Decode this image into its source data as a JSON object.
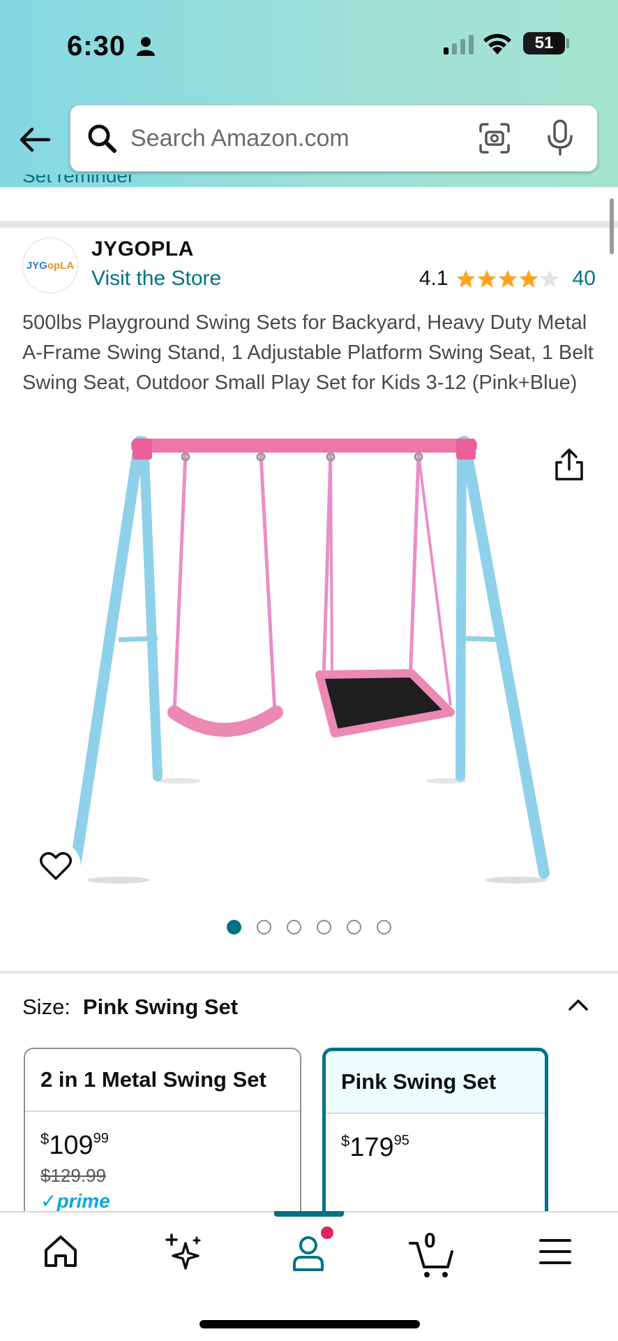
{
  "status_bar": {
    "time": "6:30",
    "battery": "51"
  },
  "search": {
    "placeholder": "Search Amazon.com"
  },
  "reminder_link": "Set reminder",
  "brand": {
    "logo_text_a": "JYG",
    "logo_text_b": "opLA",
    "name": "JYGOPLA",
    "visit_store": "Visit the Store",
    "rating": "4.1",
    "review_count": "40",
    "stars_filled": 4.1
  },
  "product": {
    "title": "500lbs Playground Swing Sets for Backyard, Heavy Duty Metal A-Frame Swing Stand, 1 Adjustable Platform Swing Seat, 1 Belt Swing Seat, Outdoor Small Play Set for Kids 3-12 (Pink+Blue)"
  },
  "gallery": {
    "image_count": 6,
    "active_index": 0
  },
  "size": {
    "label": "Size:",
    "selected": "Pink Swing Set",
    "options": [
      {
        "name": "2 in 1 Metal Swing Set",
        "currency": "$",
        "price_whole": "109",
        "price_frac": "99",
        "list_price": "$129.99",
        "prime": "prime"
      },
      {
        "name": "Pink Swing Set",
        "currency": "$",
        "price_whole": "179",
        "price_frac": "95"
      }
    ]
  },
  "nav": {
    "cart_count": "0"
  },
  "colors": {
    "link": "#007185",
    "star": "#ffa41c",
    "accent": "#007185"
  }
}
